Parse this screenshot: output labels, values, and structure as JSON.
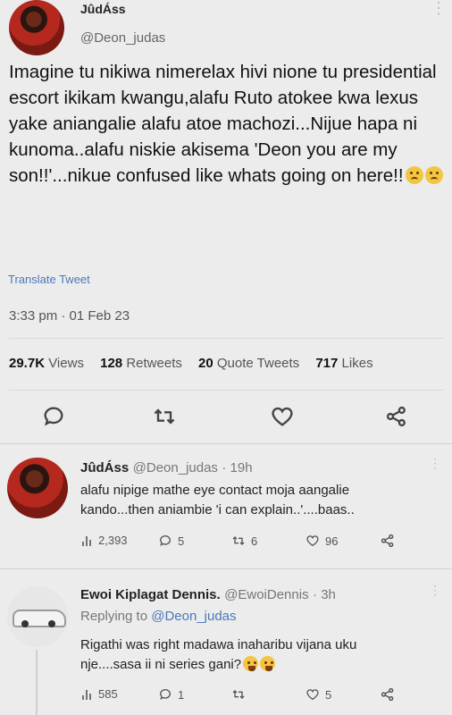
{
  "tweet": {
    "display_name": "JûdÁss",
    "handle": "@Deon_judas",
    "text": "Imagine tu nikiwa nimerelax hivi nione tu presidential escort ikikam kwangu,alafu Ruto atokee kwa lexus yake aniangalie alafu atoe machozi...Nijue hapa ni kunoma..alafu niskie akisema 'Deon you are my son!!'...nikue confused like whats going on here!!",
    "text_emojis": [
      "frowning-face",
      "frowning-face"
    ],
    "translate_label": "Translate Tweet",
    "timestamp": "3:33 pm · 01 Feb 23",
    "stats": {
      "views_count": "29.7K",
      "views_label": "Views",
      "retweets_count": "128",
      "retweets_label": "Retweets",
      "quotes_count": "20",
      "quotes_label": "Quote Tweets",
      "likes_count": "717",
      "likes_label": "Likes"
    },
    "action_icons": [
      "reply-icon",
      "retweet-icon",
      "like-icon",
      "share-icon"
    ]
  },
  "replies": [
    {
      "display_name": "JûdÁss",
      "handle": "@Deon_judas",
      "age": "· 19h",
      "line1": "alafu nipige mathe eye contact moja aangalie",
      "line2": "kando...then aniambie 'i can explain..'....baas..",
      "views": "2,393",
      "replies": "5",
      "retweets": "6",
      "likes": "96"
    },
    {
      "display_name": "Ewoi Kiplagat Dennis.",
      "handle": "@EwoiDennis",
      "age": "· 3h",
      "replying_prefix": "Replying to",
      "replying_to": "@Deon_judas",
      "line1": "Rigathi was right madawa inaharibu vijana uku",
      "line2": "nje....sasa ii ni series gani?",
      "line2_emojis": [
        "laughing-face",
        "laughing-face"
      ],
      "views": "585",
      "replies": "1",
      "retweets": "",
      "likes": "5"
    }
  ],
  "colors": {
    "background": "#ececec",
    "link": "#4a79b8",
    "text": "#111111",
    "muted": "#555555"
  }
}
